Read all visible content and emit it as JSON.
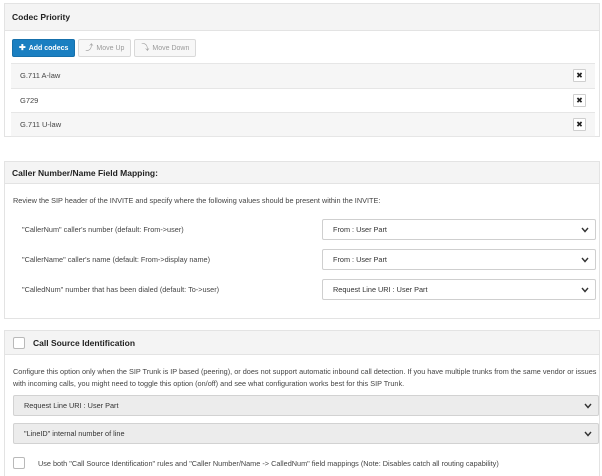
{
  "codec_priority": {
    "title": "Codec Priority",
    "buttons": {
      "add": "Add codecs",
      "move_up": "Move Up",
      "move_down": "Move Down"
    },
    "codecs": [
      "G.711 A-law",
      "G729",
      "G.711 U-law"
    ],
    "remove_icon": "close-icon"
  },
  "mapping": {
    "title": "Caller Number/Name Field Mapping:",
    "description": "Review the SIP header of the INVITE and specify where the following values should be present within the INVITE:",
    "rows": [
      {
        "label": "\"CallerNum\" caller's number (default: From->user)",
        "value": "From : User Part"
      },
      {
        "label": "\"CallerName\" caller's name (default: From->display name)",
        "value": "From : User Part"
      },
      {
        "label": "\"CalledNum\" number that has been dialed (default: To->user)",
        "value": "Request Line URI : User Part"
      }
    ]
  },
  "call_source": {
    "title": "Call Source Identification",
    "checked": false,
    "description": "Configure this option only when the SIP Trunk is IP based (peering), or does not support automatic inbound call detection. If you have multiple trunks from the same vendor or issues with incoming calls, you might need to toggle this option (on/off)  and see what configuration works best for this SIP Trunk.",
    "select1": "Request Line URI : User Part",
    "select2": "\"LineID\" internal number of line",
    "use_both_label": "Use both \"Call Source Identification\" rules and \"Caller Number/Name -> CalledNum\" field mappings (Note: Disables catch all routing capability)",
    "use_both_checked": false
  },
  "colors": {
    "primary_button": "#1a7fc1",
    "panel_header": "#f4f4f4"
  }
}
